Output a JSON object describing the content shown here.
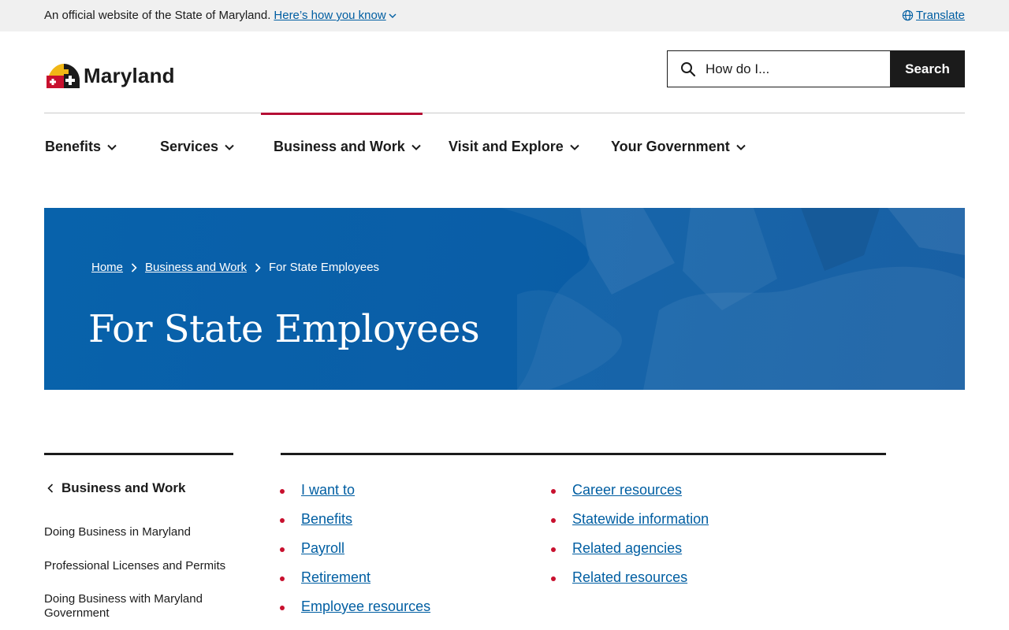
{
  "banner": {
    "text": "An official website of the State of Maryland.",
    "link": "Here’s how you know",
    "translate": "Translate"
  },
  "logo": {
    "text": "Maryland"
  },
  "search": {
    "placeholder": "How do I...",
    "button": "Search"
  },
  "nav": [
    {
      "label": "Benefits"
    },
    {
      "label": "Services"
    },
    {
      "label": "Business and Work",
      "active": true
    },
    {
      "label": "Visit and Explore"
    },
    {
      "label": "Your Government"
    }
  ],
  "breadcrumb": [
    "Home",
    "Business and Work",
    "For State Employees"
  ],
  "hero": {
    "title": "For State Employees"
  },
  "sidebar": {
    "back_label": "Business and Work",
    "links": [
      "Doing Business in Maryland",
      "Professional Licenses and Permits",
      "Doing Business with Maryland Government"
    ]
  },
  "links": {
    "col1": [
      "I want to",
      "Benefits",
      "Payroll",
      "Retirement",
      "Employee resources"
    ],
    "col2": [
      "Career resources",
      "Statewide information",
      "Related agencies",
      "Related resources"
    ]
  },
  "colors": {
    "link": "#005ea2",
    "accent_red": "#c8102e",
    "hero_blue": "#0a5ea7",
    "dark": "#1b1b1b"
  }
}
